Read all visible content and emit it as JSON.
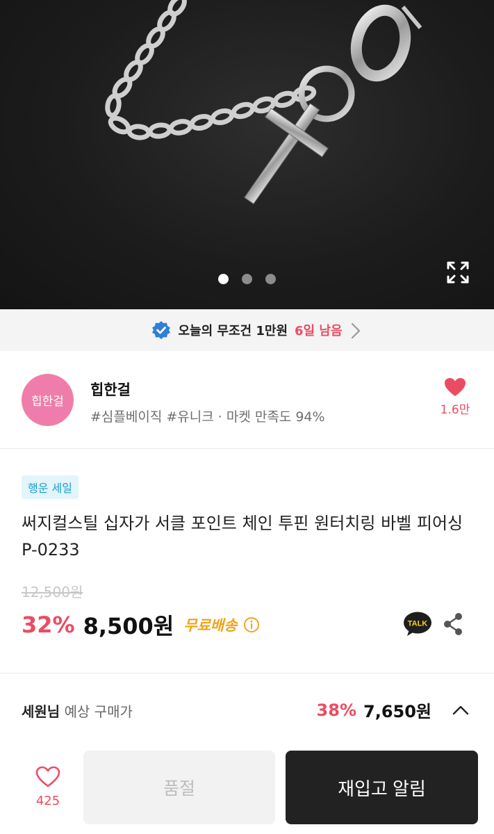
{
  "gallery": {
    "image_alt": "",
    "slide_count": 3,
    "active_index": 0,
    "icons": {
      "expand": "expand-icon"
    }
  },
  "promo": {
    "text": "오늘의 무조건 1만원",
    "highlight": "6일 남음",
    "icons": {
      "check": "verified-check-icon",
      "arrow": "chevron-right-icon"
    },
    "colors": {
      "check": "#2f7fd6",
      "highlight": "#ec4c63"
    }
  },
  "shop": {
    "logo_text": "힙한걸",
    "name": "힙한걸",
    "tags": "#심플베이직 #유니크 · 마켓 만족도 94%",
    "like_count": "1.6만",
    "colors": {
      "logo_bg": "#ee7dab",
      "heart": "#ec4c63"
    }
  },
  "product": {
    "badge": "행운 세일",
    "title": "써지컬스틸 십자가 서클 포인트 체인 투핀 원터치링 바벨 피어싱 P-0233",
    "original_price": "12,500원",
    "discount": "32%",
    "price": "8,500원",
    "shipping": "무료배송",
    "icons": {
      "info": "info-icon",
      "talk": "kakao-talk-icon",
      "share": "share-icon"
    }
  },
  "estimate": {
    "user": "세원님",
    "label": "예상 구매가",
    "discount": "38%",
    "price": "7,650원",
    "icons": {
      "toggle": "chevron-up-icon"
    }
  },
  "bottom_bar": {
    "wish_count": "425",
    "soldout_label": "품절",
    "restock_label": "재입고 알림",
    "icons": {
      "wish": "heart-outline-icon"
    }
  }
}
